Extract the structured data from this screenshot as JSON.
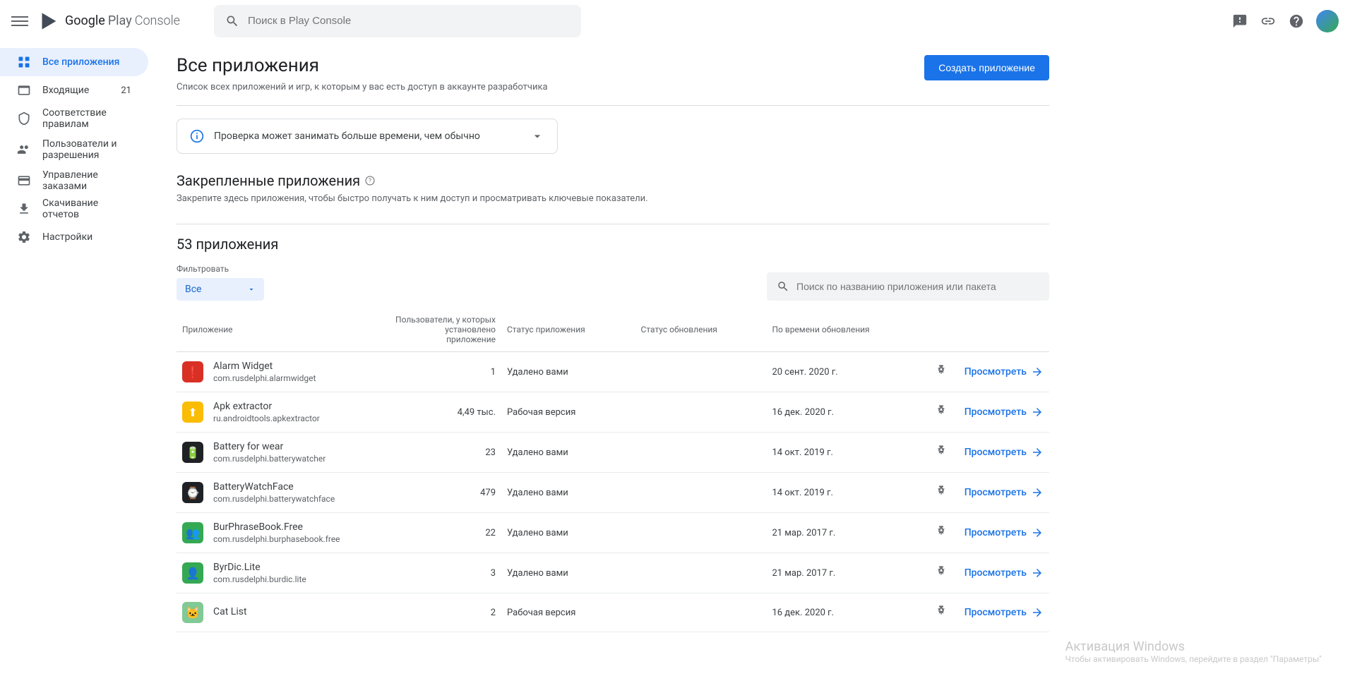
{
  "brand": {
    "google": "Google",
    "play": "Play",
    "console": "Console"
  },
  "search": {
    "placeholder": "Поиск в Play Console"
  },
  "sidebar": {
    "items": [
      {
        "label": "Все приложения",
        "active": true
      },
      {
        "label": "Входящие",
        "badge": "21"
      },
      {
        "label": "Соответствие правилам"
      },
      {
        "label": "Пользователи и разрешения"
      },
      {
        "label": "Управление заказами"
      },
      {
        "label": "Скачивание отчетов"
      },
      {
        "label": "Настройки"
      }
    ]
  },
  "page": {
    "title": "Все приложения",
    "subtitle": "Список всех приложений и игр, к которым у вас есть доступ в аккаунте разработчика",
    "create_btn": "Создать приложение"
  },
  "info": {
    "text": "Проверка может занимать больше времени, чем обычно"
  },
  "pinned": {
    "title": "Закрепленные приложения",
    "subtitle": "Закрепите здесь приложения, чтобы быстро получать к ним доступ и просматривать ключевые показатели."
  },
  "apps": {
    "count_title": "53 приложения",
    "filter_label": "Фильтровать",
    "filter_value": "Все",
    "table_search_placeholder": "Поиск по названию приложения или пакета",
    "view_label": "Просмотреть",
    "columns": {
      "app": "Приложение",
      "installs": "Пользователи, у которых установлено приложение",
      "status": "Статус приложения",
      "update_status": "Статус обновления",
      "update_time": "По времени обновления"
    },
    "rows": [
      {
        "name": "Alarm Widget",
        "pkg": "com.rusdelphi.alarmwidget",
        "installs": "1",
        "status": "Удалено вами",
        "update_status": "",
        "update_time": "20 сент. 2020 г.",
        "icon_bg": "#d93025",
        "icon_glyph": "❗"
      },
      {
        "name": "Apk extractor",
        "pkg": "ru.androidtools.apkextractor",
        "installs": "4,49 тыс.",
        "status": "Рабочая версия",
        "update_status": "",
        "update_time": "16 дек. 2020 г.",
        "icon_bg": "#fbbc04",
        "icon_glyph": "⬆"
      },
      {
        "name": "Battery for wear",
        "pkg": "com.rusdelphi.batterywatcher",
        "installs": "23",
        "status": "Удалено вами",
        "update_status": "",
        "update_time": "14 окт. 2019 г.",
        "icon_bg": "#202124",
        "icon_glyph": "🔋"
      },
      {
        "name": "BatteryWatchFace",
        "pkg": "com.rusdelphi.batterywatchface",
        "installs": "479",
        "status": "Удалено вами",
        "update_status": "",
        "update_time": "14 окт. 2019 г.",
        "icon_bg": "#202124",
        "icon_glyph": "⌚"
      },
      {
        "name": "BurPhraseBook.Free",
        "pkg": "com.rusdelphi.burphasebook.free",
        "installs": "22",
        "status": "Удалено вами",
        "update_status": "",
        "update_time": "21 мар. 2017 г.",
        "icon_bg": "#34a853",
        "icon_glyph": "👥"
      },
      {
        "name": "ByrDic.Lite",
        "pkg": "com.rusdelphi.burdic.lite",
        "installs": "3",
        "status": "Удалено вами",
        "update_status": "",
        "update_time": "21 мар. 2017 г.",
        "icon_bg": "#34a853",
        "icon_glyph": "👤"
      },
      {
        "name": "Cat List",
        "pkg": "",
        "installs": "2",
        "status": "Рабочая версия",
        "update_status": "",
        "update_time": "16 дек. 2020 г.",
        "icon_bg": "#81c995",
        "icon_glyph": "🐱"
      }
    ]
  },
  "watermark": {
    "title": "Активация Windows",
    "sub": "Чтобы активировать Windows, перейдите в раздел \"Параметры\""
  }
}
